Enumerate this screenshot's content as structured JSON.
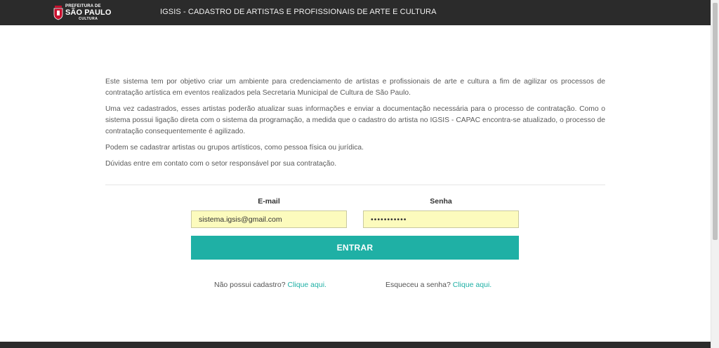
{
  "header": {
    "logo": {
      "line1": "PREFEITURA DE",
      "line2": "SÃO PAULO",
      "line3": "CULTURA"
    },
    "title": "IGSIS - CADASTRO DE ARTISTAS E PROFISSIONAIS DE ARTE E CULTURA"
  },
  "intro": {
    "p1": "Este sistema tem por objetivo criar um ambiente para credenciamento de artistas e profissionais de arte e cultura a fim de agilizar os processos de contratação artística em eventos realizados pela Secretaria Municipal de Cultura de São Paulo.",
    "p2": "Uma vez cadastrados, esses artistas poderão atualizar suas informações e enviar a documentação necessária para o processo de contratação. Como o sistema possui ligação direta com o sistema da programação, a medida que o cadastro do artista no IGSIS - CAPAC encontra-se atualizado, o processo de contratação consequentemente é agilizado.",
    "p3": "Podem se cadastrar artistas ou grupos artísticos, como pessoa física ou jurídica.",
    "p4": "Dúvidas entre em contato com o setor responsável por sua contratação."
  },
  "login": {
    "email_label": "E-mail",
    "email_value": "sistema.igsis@gmail.com",
    "senha_label": "Senha",
    "senha_value": "•••••••••••",
    "submit_label": "ENTRAR"
  },
  "links": {
    "cadastro_text": "Não possui cadastro?",
    "cadastro_link": "Clique aqui.",
    "senha_text": "Esqueceu a senha?",
    "senha_link": "Clique aqui."
  },
  "colors": {
    "header_bg": "#2b2b2b",
    "accent": "#1fb0a5",
    "input_bg": "#fcfbbd"
  }
}
